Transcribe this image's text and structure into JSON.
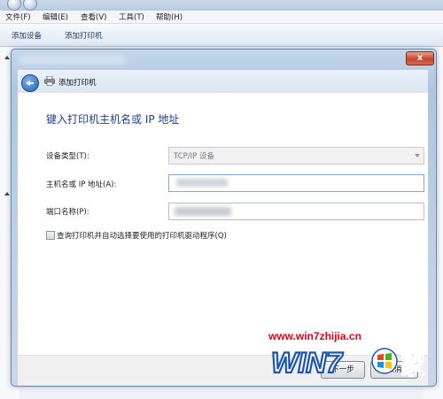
{
  "menubar": {
    "items": [
      "文件(F)",
      "编辑(E)",
      "查看(V)",
      "工具(T)",
      "帮助(H)"
    ]
  },
  "commandbar": {
    "add_device": "添加设备",
    "add_printer": "添加打印机"
  },
  "dialog": {
    "title": "添加打印机",
    "heading": "键入打印机主机名或 IP 地址",
    "device_type_label": "设备类型(T):",
    "device_type_value": "TCP/IP 设备",
    "hostname_label": "主机名或 IP 地址(A):",
    "port_label": "端口名称(P):",
    "query_checkbox_label": "查询打印机并自动选择要使用的打印机驱动程序(Q)",
    "next_button": "下一步",
    "cancel_button": "取消",
    "close_glyph": "x"
  },
  "watermark": {
    "url": "www.win7zhijia.cn",
    "logo_text": "WIN7",
    "logo_suffix": "家"
  },
  "colors": {
    "heading": "#1f3d8f",
    "watermark_red": "#e4001a",
    "logo_blue": "#1a56b0"
  }
}
